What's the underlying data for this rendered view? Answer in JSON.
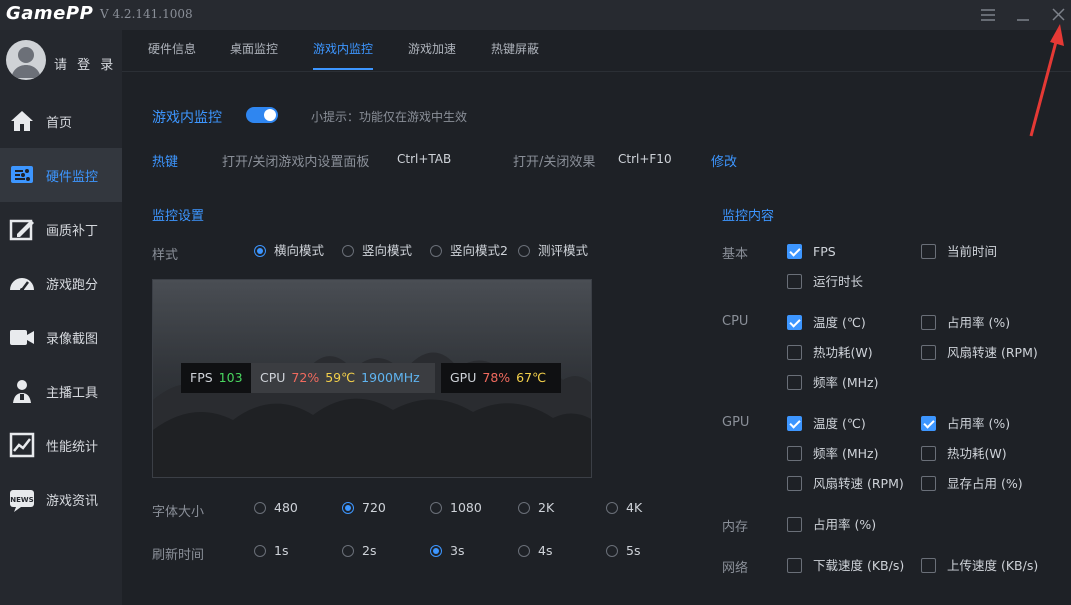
{
  "app": {
    "logo": "GamePP",
    "version": "V 4.2.141.1008"
  },
  "sidebar": {
    "login": "请 登 录",
    "items": [
      {
        "label": "首页",
        "icon": "home-icon"
      },
      {
        "label": "硬件监控",
        "icon": "hardware-monitor-icon"
      },
      {
        "label": "画质补丁",
        "icon": "image-quality-icon"
      },
      {
        "label": "游戏跑分",
        "icon": "speedometer-icon"
      },
      {
        "label": "录像截图",
        "icon": "camera-icon"
      },
      {
        "label": "主播工具",
        "icon": "streamer-icon"
      },
      {
        "label": "性能统计",
        "icon": "chart-icon"
      },
      {
        "label": "游戏资讯",
        "icon": "news-icon"
      }
    ],
    "active_index": 1
  },
  "tabs": [
    "硬件信息",
    "桌面监控",
    "游戏内监控",
    "游戏加速",
    "热键屏蔽"
  ],
  "active_tab": 2,
  "ingame": {
    "title": "游戏内监控",
    "enabled": true,
    "hint": "小提示：功能仅在游戏中生效"
  },
  "hotkey": {
    "label": "热键",
    "panel_label": "打开/关闭游戏内设置面板",
    "panel_key": "Ctrl+TAB",
    "effect_label": "打开/关闭效果",
    "effect_key": "Ctrl+F10",
    "modify": "修改"
  },
  "monitor_settings": {
    "title": "监控设置",
    "style_label": "样式",
    "styles": [
      "横向模式",
      "竖向模式",
      "竖向模式2",
      "测评模式"
    ],
    "style_selected": 0,
    "font_label": "字体大小",
    "fonts": [
      "480",
      "720",
      "1080",
      "2K",
      "4K"
    ],
    "font_selected": 1,
    "refresh_label": "刷新时间",
    "refresh": [
      "1s",
      "2s",
      "3s",
      "4s",
      "5s"
    ],
    "refresh_selected": 2
  },
  "preview": {
    "fps_label": "FPS",
    "fps_value": "103",
    "cpu_label": "CPU",
    "cpu_usage": "72%",
    "cpu_temp": "59℃",
    "cpu_freq": "1900MHz",
    "gpu_label": "GPU",
    "gpu_usage": "78%",
    "gpu_temp": "67℃",
    "colors": {
      "fps": "#49d65f",
      "usage": "#f06a5e",
      "temp": "#f2cf4a",
      "freq": "#5fb4f0"
    }
  },
  "monitor_content": {
    "title": "监控内容",
    "groups": {
      "basic": {
        "label": "基本",
        "items": [
          {
            "label": "FPS",
            "checked": true
          },
          {
            "label": "当前时间",
            "checked": false
          },
          {
            "label": "运行时长",
            "checked": false
          }
        ]
      },
      "cpu": {
        "label": "CPU",
        "items": [
          {
            "label": "温度 (℃)",
            "checked": true
          },
          {
            "label": "占用率 (%)",
            "checked": false
          },
          {
            "label": "热功耗(W)",
            "checked": false
          },
          {
            "label": "风扇转速 (RPM)",
            "checked": false
          },
          {
            "label": "频率 (MHz)",
            "checked": false
          }
        ]
      },
      "gpu": {
        "label": "GPU",
        "items": [
          {
            "label": "温度 (℃)",
            "checked": true
          },
          {
            "label": "占用率 (%)",
            "checked": true
          },
          {
            "label": "频率 (MHz)",
            "checked": false
          },
          {
            "label": "热功耗(W)",
            "checked": false
          },
          {
            "label": "风扇转速 (RPM)",
            "checked": false
          },
          {
            "label": "显存占用 (%)",
            "checked": false
          }
        ]
      },
      "memory": {
        "label": "内存",
        "items": [
          {
            "label": "占用率 (%)",
            "checked": false
          }
        ]
      },
      "network": {
        "label": "网络",
        "items": [
          {
            "label": "下载速度 (KB/s)",
            "checked": false
          },
          {
            "label": "上传速度 (KB/s)",
            "checked": false
          }
        ]
      }
    }
  },
  "colors": {
    "accent": "#3d96ff",
    "background": "#1e2126",
    "sidebar": "#25282e",
    "annotation_arrow": "#e53935"
  }
}
